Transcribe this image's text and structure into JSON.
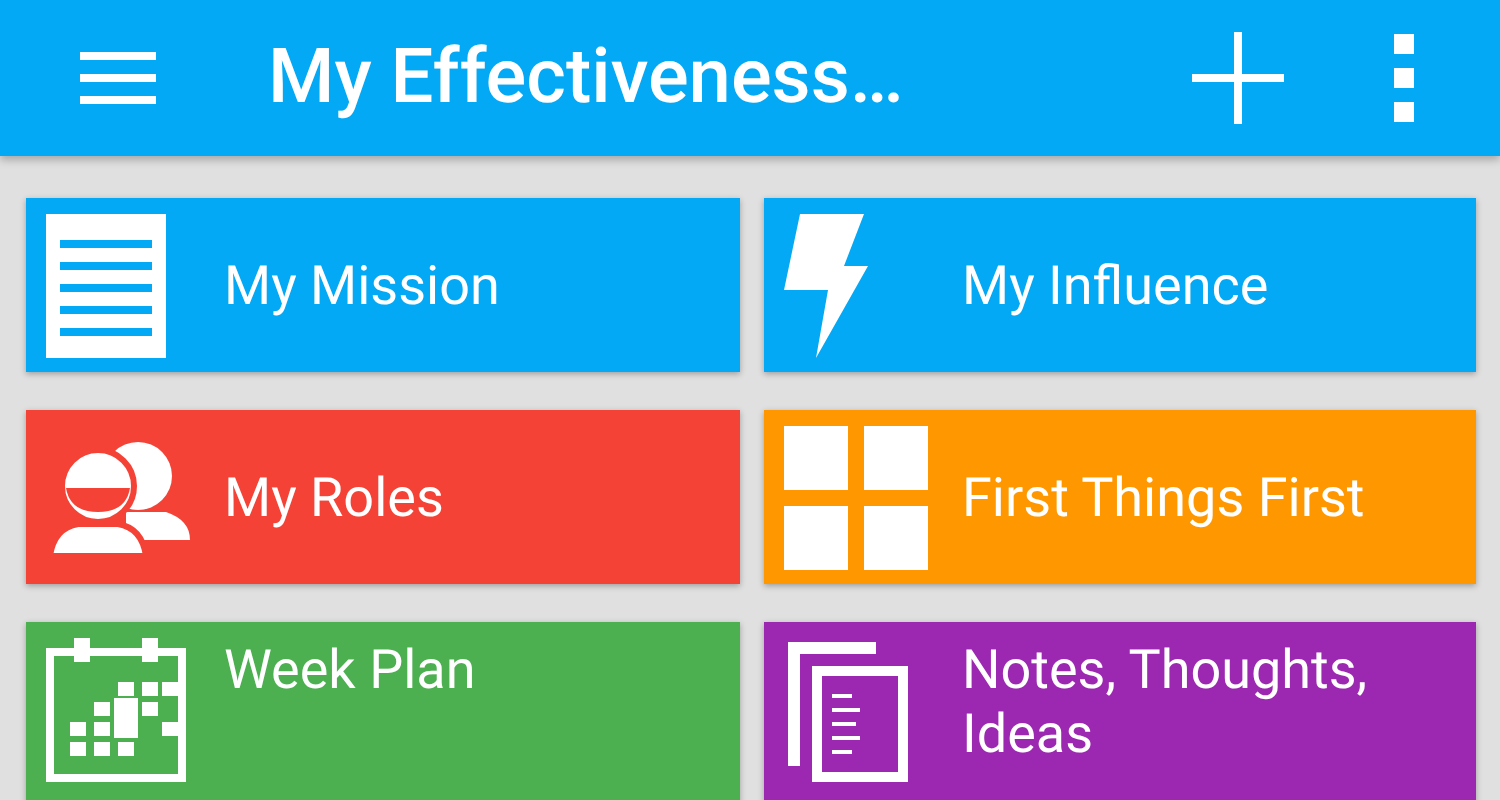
{
  "app_bar": {
    "title": "My Effectiveness…"
  },
  "tiles": [
    {
      "label": "My Mission",
      "kind": "document",
      "color": "#03a9f4"
    },
    {
      "label": "My Influence",
      "kind": "bolt",
      "color": "#03a9f4"
    },
    {
      "label": "My Roles",
      "kind": "people",
      "color": "#f44336"
    },
    {
      "label": "First Things First",
      "kind": "grid",
      "color": "#ff9800"
    },
    {
      "label": "Week Plan",
      "kind": "calendar",
      "color": "#4caf50"
    },
    {
      "label": "Notes, Thoughts, Ideas",
      "kind": "notes",
      "color": "#9c27b0"
    }
  ]
}
